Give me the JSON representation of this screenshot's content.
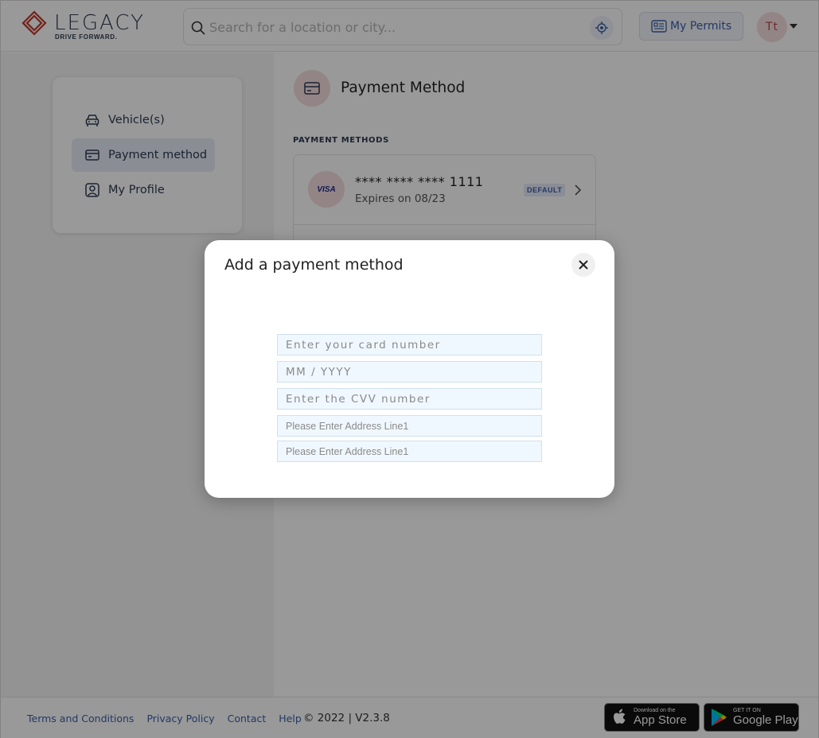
{
  "header": {
    "logo_text": "LEGACY",
    "logo_tagline": "DRIVE FORWARD.",
    "search_placeholder": "Search for a location or city...",
    "permits_label": "My Permits",
    "avatar_initials": "Tt"
  },
  "sidebar": {
    "items": [
      {
        "label": "Vehicle(s)",
        "icon": "car-icon",
        "active": false
      },
      {
        "label": "Payment method",
        "icon": "credit-card-icon",
        "active": true
      },
      {
        "label": "My Profile",
        "icon": "profile-icon",
        "active": false
      }
    ]
  },
  "main": {
    "title": "Payment Method",
    "section_label": "PAYMENT METHODS",
    "cards": [
      {
        "brand": "VISA",
        "number": "**** **** **** 1111",
        "expiry": "Expires on 08/23",
        "badge": "DEFAULT"
      }
    ]
  },
  "modal": {
    "title": "Add a payment method",
    "fields": {
      "card_number": "Enter your card number",
      "expiry": "MM / YYYY",
      "cvv": "Enter the CVV number",
      "address1": "Please Enter Address Line1",
      "address2": "Please Enter Address Line1"
    }
  },
  "footer": {
    "links": [
      "Terms and Conditions",
      "Privacy Policy",
      "Contact",
      "Help"
    ],
    "copyright": "© 2022 | V2.3.8",
    "appstore_small": "Download on the",
    "appstore_big": "App Store",
    "gplay_small": "GET IT ON",
    "gplay_big": "Google Play"
  },
  "colors": {
    "accent": "#3a5fa8",
    "brand_red": "#c0392b",
    "avatar_bg": "#f6dede",
    "field_bg": "#f0f8ff"
  }
}
